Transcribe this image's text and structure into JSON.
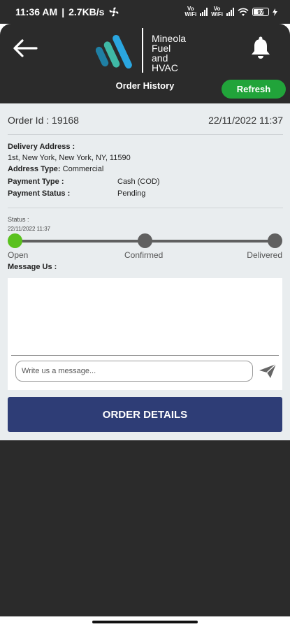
{
  "status_bar": {
    "time": "11:36 AM",
    "net_speed": "2.7KB/s",
    "volte1_top": "Vo",
    "volte1_bottom": "WiFi",
    "volte2_top": "Vo",
    "volte2_bottom": "WiFi",
    "battery": "97"
  },
  "header": {
    "logo_line1": "Mineola",
    "logo_line2": "Fuel",
    "logo_line3": "and",
    "logo_line4": "HVAC",
    "title": "Order History",
    "refresh_label": "Refresh",
    "colors": {
      "background": "#2b2b2b",
      "refresh": "#21a43a"
    }
  },
  "order": {
    "id_label": "Order Id :",
    "id_value": "19168",
    "datetime": "22/11/2022 11:37",
    "delivery_address_label": "Delivery Address :",
    "delivery_address": "1st, New York, New York, NY, 11590",
    "address_type_label": "Address Type:",
    "address_type": "Commercial",
    "payment_type_label": "Payment Type :",
    "payment_type": "Cash (COD)",
    "payment_status_label": "Payment Status :",
    "payment_status": "Pending"
  },
  "status": {
    "label": "Status :",
    "timestamp": "22/11/2022 11:37",
    "steps": [
      "Open",
      "Confirmed",
      "Delivered"
    ],
    "current_step": 0,
    "colors": {
      "active": "#5ac11e",
      "inactive": "#606060"
    }
  },
  "message": {
    "label": "Message Us :",
    "placeholder": "Write us a message..."
  },
  "actions": {
    "order_details_label": "ORDER DETAILS",
    "colors": {
      "order_details": "#2e3d76"
    }
  },
  "icons": {
    "back": "arrow-left-icon",
    "bell": "bell-icon",
    "send": "send-icon",
    "logo": "mineola-logo"
  }
}
